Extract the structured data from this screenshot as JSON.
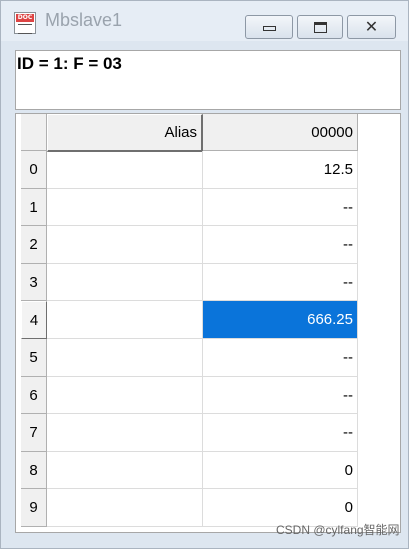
{
  "window": {
    "title": "Mbslave1",
    "close_glyph": "✕"
  },
  "header": {
    "text": "ID = 1: F = 03"
  },
  "grid": {
    "columns": [
      "Alias",
      "00000"
    ],
    "selected_row": 4,
    "selection_color": "#0A74DA",
    "rows": [
      {
        "index": "0",
        "alias": "",
        "value": "12.5"
      },
      {
        "index": "1",
        "alias": "",
        "value": "--"
      },
      {
        "index": "2",
        "alias": "",
        "value": "--"
      },
      {
        "index": "3",
        "alias": "",
        "value": "--"
      },
      {
        "index": "4",
        "alias": "",
        "value": "666.25"
      },
      {
        "index": "5",
        "alias": "",
        "value": "--"
      },
      {
        "index": "6",
        "alias": "",
        "value": "--"
      },
      {
        "index": "7",
        "alias": "",
        "value": "--"
      },
      {
        "index": "8",
        "alias": "",
        "value": "0"
      },
      {
        "index": "9",
        "alias": "",
        "value": "0"
      }
    ]
  },
  "watermark": "CSDN @cylfang智能网"
}
